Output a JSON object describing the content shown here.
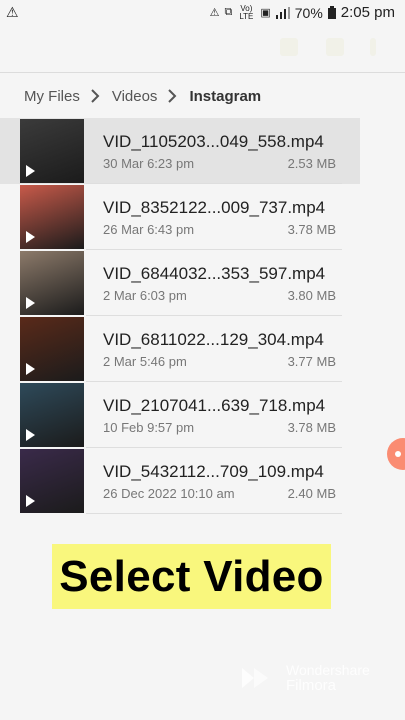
{
  "status_bar": {
    "battery": "70%",
    "time": "2:05 pm",
    "network_label": "Vo) LTE"
  },
  "breadcrumb": [
    "My Files",
    "Videos",
    "Instagram"
  ],
  "files": [
    {
      "name": "VID_1105203...049_558.mp4",
      "date": "30 Mar 6:23 pm",
      "size": "2.53 MB",
      "selected": true
    },
    {
      "name": "VID_8352122...009_737.mp4",
      "date": "26 Mar 6:43 pm",
      "size": "3.78 MB",
      "selected": false
    },
    {
      "name": "VID_6844032...353_597.mp4",
      "date": "2 Mar 6:03 pm",
      "size": "3.80 MB",
      "selected": false
    },
    {
      "name": "VID_6811022...129_304.mp4",
      "date": "2 Mar 5:46 pm",
      "size": "3.77 MB",
      "selected": false
    },
    {
      "name": "VID_2107041...639_718.mp4",
      "date": "10 Feb 9:57 pm",
      "size": "3.78 MB",
      "selected": false
    },
    {
      "name": "VID_5432112...709_109.mp4",
      "date": "26 Dec 2022 10:10 am",
      "size": "2.40 MB",
      "selected": false
    }
  ],
  "thumb_colors": [
    "#3b3b3b",
    "#c85a4a",
    "#8c7a6a",
    "#5a2a1a",
    "#2e4a5a",
    "#3a2a4a"
  ],
  "overlay": {
    "text": "Select Video"
  },
  "watermark": {
    "line1": "Wondershare",
    "line2": "Filmora"
  }
}
